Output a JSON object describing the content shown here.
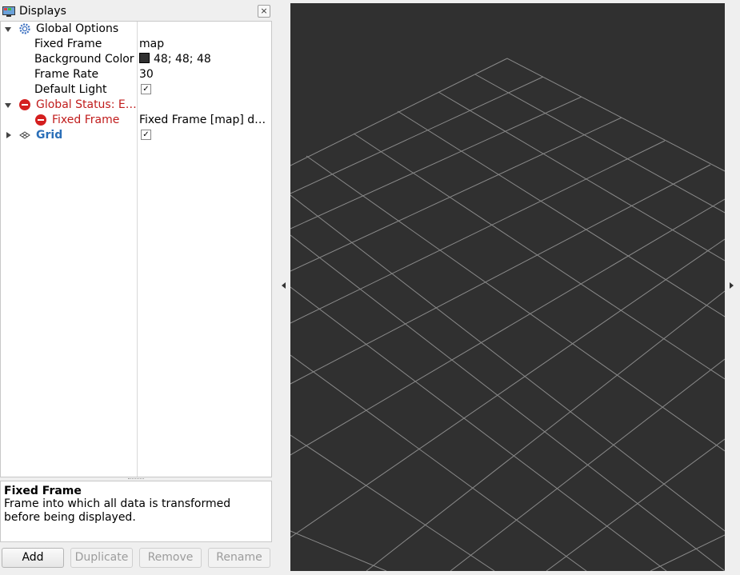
{
  "panel": {
    "title": "Displays",
    "close_symbol": "×"
  },
  "tree": [
    {
      "label": "Global Options",
      "value": "",
      "icon": "gear-icon"
    },
    {
      "label": "Fixed Frame",
      "value": "map"
    },
    {
      "label": "Background Color",
      "value": "48; 48; 48",
      "color": "#303030"
    },
    {
      "label": "Frame Rate",
      "value": "30"
    },
    {
      "label": "Default Light",
      "value": "",
      "checked": true
    },
    {
      "label": "Global Status: E…",
      "value": "",
      "icon": "error-icon",
      "status_color": "#c01c1c"
    },
    {
      "label": "Fixed Frame",
      "value": "Fixed Frame [map] do…",
      "icon": "error-icon"
    },
    {
      "label": "Grid",
      "value": "",
      "icon": "grid-icon",
      "checked": true,
      "label_color": "#2b6fb8"
    }
  ],
  "description": {
    "title": "Fixed Frame",
    "text": "Frame into which all data is transformed before being displayed."
  },
  "buttons": {
    "add": "Add",
    "duplicate": "Duplicate",
    "remove": "Remove",
    "rename": "Rename"
  },
  "viewport": {
    "background": "#303030",
    "grid_color": "#8a8a8a"
  }
}
